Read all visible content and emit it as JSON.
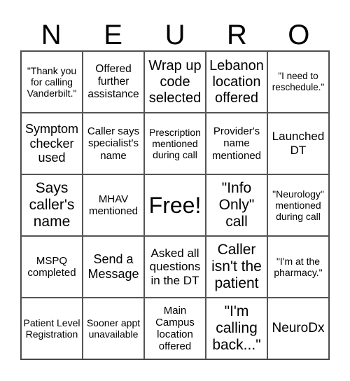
{
  "title_letters": [
    "N",
    "E",
    "U",
    "R",
    "O"
  ],
  "cells": [
    "\"Thank you for calling Vanderbilt.\"",
    "Offered further assistance",
    "Wrap up code selected",
    "Lebanon location offered",
    "\"I need to reschedule.\"",
    "Symptom checker used",
    "Caller says specialist's name",
    "Prescription mentioned during call",
    "Provider's name mentioned",
    "Launched DT",
    "Says caller's name",
    "MHAV mentioned",
    "Free!",
    "\"Info Only\" call",
    "\"Neurology\" mentioned during call",
    "MSPQ completed",
    "Send a Message",
    "Asked all questions in the DT",
    "Caller isn't the patient",
    "\"I'm at the pharmacy.\"",
    "Patient Level Registration",
    "Sooner appt unavailable",
    "Main Campus location offered",
    "\"I'm calling back...\"",
    "NeuroDx"
  ]
}
